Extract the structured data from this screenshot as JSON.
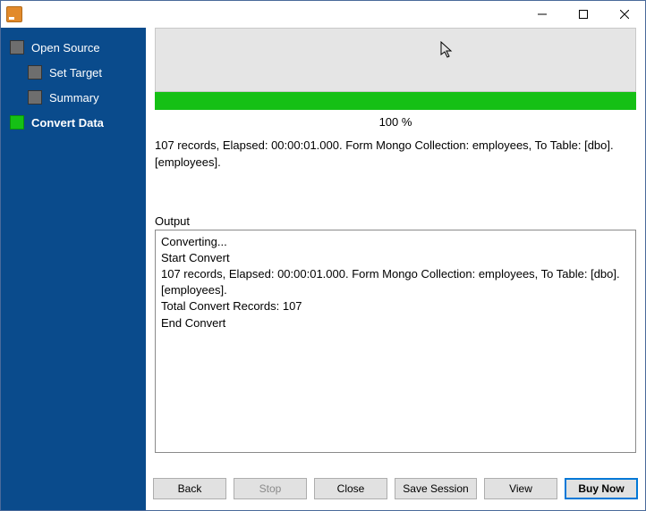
{
  "titlebar": {
    "title": ""
  },
  "sidebar": {
    "items": [
      {
        "label": "Open Source",
        "indent": false,
        "active": false
      },
      {
        "label": "Set Target",
        "indent": true,
        "active": false
      },
      {
        "label": "Summary",
        "indent": true,
        "active": false
      },
      {
        "label": "Convert Data",
        "indent": false,
        "active": true
      }
    ]
  },
  "progress": {
    "percent_label": "100 %",
    "percent": 100
  },
  "status_text": "107 records,    Elapsed: 00:00:01.000.    Form Mongo Collection: employees,    To Table: [dbo].[employees].",
  "output": {
    "label": "Output",
    "lines": [
      "Converting...",
      "Start Convert",
      "107 records,    Elapsed: 00:00:01.000.    Form Mongo Collection: employees,    To Table: [dbo].[employees].",
      "Total Convert Records: 107",
      "End Convert"
    ]
  },
  "buttons": {
    "back": "Back",
    "stop": "Stop",
    "close": "Close",
    "save_session": "Save Session",
    "view": "View",
    "buy_now": "Buy Now"
  }
}
